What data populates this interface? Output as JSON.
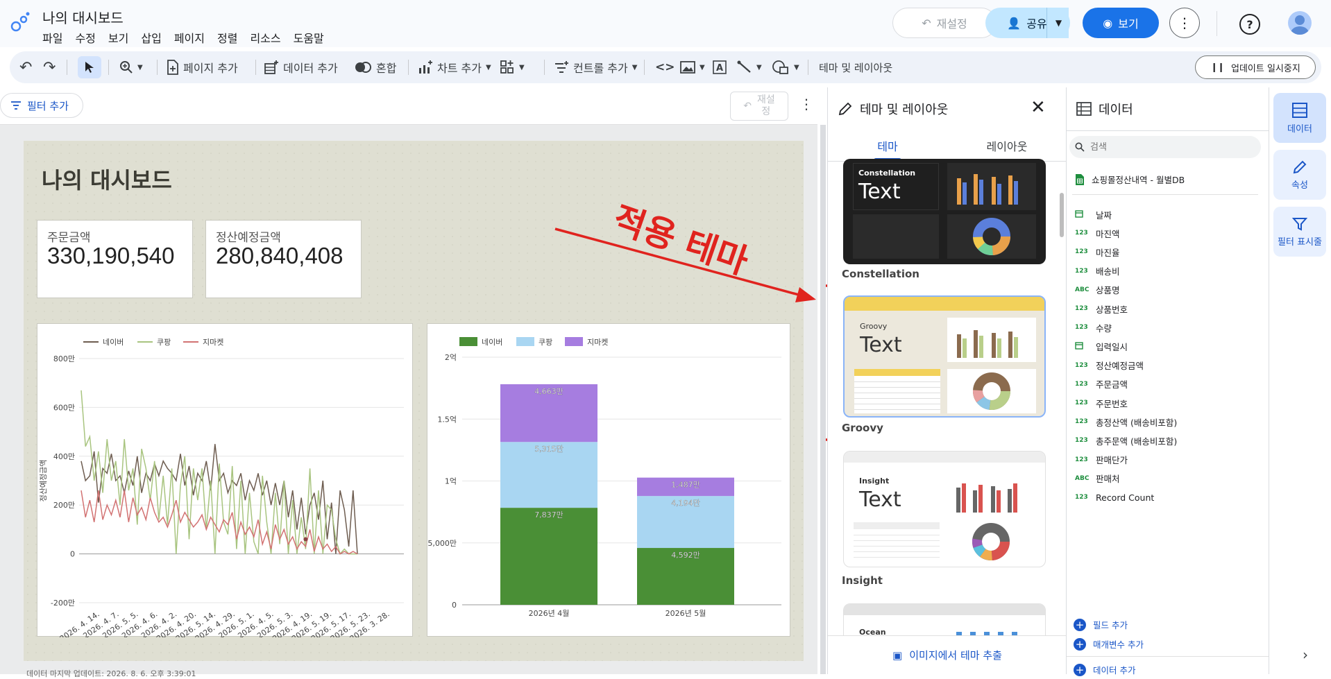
{
  "app": {
    "title": "나의 대시보드",
    "menu": [
      "파일",
      "수정",
      "보기",
      "삽입",
      "페이지",
      "정렬",
      "리소스",
      "도움말"
    ],
    "reset_label": "재설정",
    "share_label": "공유",
    "view_label": "보기"
  },
  "toolbar": {
    "add_page": "페이지 추가",
    "add_data": "데이터 추가",
    "blend": "혼합",
    "add_chart": "차트 추가",
    "add_control": "컨트롤 추가",
    "theme_layout": "테마 및 레이아웃",
    "pause_updates": "업데이트 일시중지"
  },
  "filterbar": {
    "add_filter": "필터 추가",
    "reset_line1": "재설",
    "reset_line2": "정"
  },
  "report": {
    "title": "나의 대시보드",
    "scorecards": [
      {
        "label": "주문금액",
        "value": "330,190,540"
      },
      {
        "label": "정산예정금액",
        "value": "280,840,408"
      }
    ],
    "annotation": "적용 테마",
    "footer": "데이터 마지막 업데이트: 2026. 8. 6. 오후 3:39:01"
  },
  "chart_data": [
    {
      "type": "line",
      "ylabel": "정산예정금액",
      "y_ticks": [
        "800만",
        "600만",
        "400만",
        "200만",
        "0",
        "-200만"
      ],
      "y_tick_values": [
        800,
        600,
        400,
        200,
        0,
        -200
      ],
      "ylim": [
        -200,
        800
      ],
      "x_tick_labels": [
        "2026. 4. 14.",
        "2026. 4. 7.",
        "2026. 5. 5.",
        "2026. 4. 6.",
        "2026. 4. 2.",
        "2026. 4. 20.",
        "2026. 5. 14.",
        "2026. 4. 29.",
        "2026. 5. 1.",
        "2026. 4. 5.",
        "2026. 5. 3.",
        "2026. 4. 19.",
        "2026. 5. 19.",
        "2026. 5. 17.",
        "2026. 5. 23.",
        "2026. 3. 28."
      ],
      "legend": "top",
      "series": [
        {
          "name": "네이버",
          "color": "#6d5c4f",
          "values": [
            380,
            300,
            320,
            420,
            210,
            350,
            330,
            410,
            300,
            320,
            250,
            340,
            280,
            400,
            250,
            330,
            300,
            370,
            320,
            380,
            350,
            330,
            300,
            410,
            280,
            360,
            240,
            330,
            300,
            380,
            260,
            450,
            300,
            330,
            250,
            300,
            280,
            330,
            220,
            300,
            260,
            330,
            240,
            300,
            200,
            290,
            200,
            300,
            150,
            260,
            100,
            230,
            80,
            200,
            250,
            140,
            300,
            60,
            210,
            0,
            260,
            180,
            30,
            260,
            0
          ]
        },
        {
          "name": "쿠팡",
          "color": "#a8c47f",
          "values": [
            670,
            440,
            480,
            300,
            420,
            250,
            470,
            300,
            380,
            200,
            470,
            260,
            350,
            120,
            430,
            350,
            220,
            380,
            140,
            320,
            120,
            350,
            0,
            280,
            400,
            60,
            350,
            220,
            350,
            100,
            300,
            0,
            370,
            130,
            80,
            360,
            20,
            300,
            0,
            250,
            50,
            0,
            320,
            130,
            0,
            250,
            40,
            300,
            0,
            220,
            0,
            150,
            20,
            350,
            0,
            260,
            0,
            200,
            180,
            60,
            0,
            20,
            0,
            0,
            0
          ]
        },
        {
          "name": "지마켓",
          "color": "#d27272",
          "values": [
            260,
            150,
            220,
            130,
            260,
            140,
            200,
            160,
            220,
            150,
            260,
            130,
            230,
            160,
            190,
            140,
            230,
            170,
            130,
            150,
            110,
            160,
            220,
            130,
            170,
            140,
            110,
            130,
            160,
            100,
            150,
            120,
            90,
            140,
            120,
            170,
            60,
            130,
            80,
            110,
            70,
            140,
            40,
            90,
            20,
            120,
            60,
            100,
            40,
            70,
            20,
            50,
            30,
            100,
            10,
            70,
            20,
            40,
            10,
            30,
            0,
            10,
            0,
            10,
            0
          ]
        }
      ]
    },
    {
      "type": "bar",
      "stacked": true,
      "categories": [
        "2026년 4월",
        "2026년 5월"
      ],
      "y_ticks": [
        "2억",
        "1.5억",
        "1억",
        "5,000만",
        "0"
      ],
      "y_tick_values": [
        20000,
        15000,
        10000,
        5000,
        0
      ],
      "ylim": [
        0,
        20000
      ],
      "legend": "top",
      "series": [
        {
          "name": "네이버",
          "color": "#4a8f36",
          "values": [
            7837,
            4592
          ],
          "labels": [
            "7,837만",
            "4,592만"
          ]
        },
        {
          "name": "쿠팡",
          "color": "#a9d6f2",
          "values": [
            5315,
            4194
          ],
          "labels": [
            "5,315만",
            "4,194만"
          ]
        },
        {
          "name": "지마켓",
          "color": "#a67de0",
          "values": [
            4663,
            1487
          ],
          "labels": [
            "4,663만",
            "1,487만"
          ]
        }
      ]
    }
  ],
  "theme_panel": {
    "title": "테마 및 레이아웃",
    "tabs": [
      "테마",
      "레이아웃"
    ],
    "themes": [
      {
        "name": "Constellation",
        "sample_name": "Constellation",
        "sample_text": "Text"
      },
      {
        "name": "Groovy",
        "sample_name": "Groovy",
        "sample_text": "Text"
      },
      {
        "name": "Insight",
        "sample_name": "Insight",
        "sample_text": "Text"
      },
      {
        "name": "Ocean",
        "sample_name": "Ocean",
        "sample_text": ""
      }
    ],
    "extract_label": "이미지에서 테마 추출"
  },
  "data_panel": {
    "title": "데이터",
    "search_placeholder": "검색",
    "source": "쇼핑몰정산내역 - 월별DB",
    "fields": [
      {
        "type": "date",
        "name": "날짜"
      },
      {
        "type": "123",
        "name": "마진액"
      },
      {
        "type": "123",
        "name": "마진율"
      },
      {
        "type": "123",
        "name": "배송비"
      },
      {
        "type": "ABC",
        "name": "상품명"
      },
      {
        "type": "123",
        "name": "상품번호"
      },
      {
        "type": "123",
        "name": "수량"
      },
      {
        "type": "date",
        "name": "입력일시"
      },
      {
        "type": "123",
        "name": "정산예정금액"
      },
      {
        "type": "123",
        "name": "주문금액"
      },
      {
        "type": "123",
        "name": "주문번호"
      },
      {
        "type": "123",
        "name": "총정산액 (배송비포함)"
      },
      {
        "type": "123",
        "name": "총주문액 (배송비포함)"
      },
      {
        "type": "123",
        "name": "판매단가"
      },
      {
        "type": "ABC",
        "name": "판매처"
      },
      {
        "type": "123",
        "name": "Record Count"
      }
    ],
    "add_field": "필드 추가",
    "add_param": "매개변수 추가",
    "add_data": "데이터 추가"
  },
  "rail": {
    "data": "데이터",
    "props": "속성",
    "filter": "필터 표시줄"
  }
}
